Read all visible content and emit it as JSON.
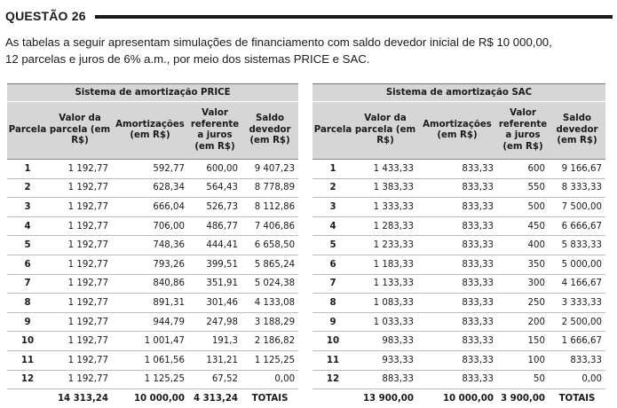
{
  "question": {
    "title": "QUESTÃO 26"
  },
  "intro": {
    "line1": "As tabelas a seguir apresentam simulações de financiamento com saldo devedor inicial de R$ 10 000,00,",
    "line2": "12 parcelas e juros de 6% a.m., por meio dos sistemas PRICE e SAC."
  },
  "tables": {
    "price": {
      "title": "Sistema de amortização PRICE",
      "headers": [
        "Parcela",
        "Valor da parcela (em R$)",
        "Amortizações (em R$)",
        "Valor referente a juros (em R$)",
        "Saldo devedor (em R$)"
      ],
      "rows": [
        [
          "1",
          "1 192,77",
          "592,77",
          "600,00",
          "9 407,23"
        ],
        [
          "2",
          "1 192,77",
          "628,34",
          "564,43",
          "8 778,89"
        ],
        [
          "3",
          "1 192,77",
          "666,04",
          "526,73",
          "8 112,86"
        ],
        [
          "4",
          "1 192,77",
          "706,00",
          "486,77",
          "7 406,86"
        ],
        [
          "5",
          "1 192,77",
          "748,36",
          "444,41",
          "6 658,50"
        ],
        [
          "6",
          "1 192,77",
          "793,26",
          "399,51",
          "5 865,24"
        ],
        [
          "7",
          "1 192,77",
          "840,86",
          "351,91",
          "5 024,38"
        ],
        [
          "8",
          "1 192,77",
          "891,31",
          "301,46",
          "4 133,08"
        ],
        [
          "9",
          "1 192,77",
          "944,79",
          "247,98",
          "3 188,29"
        ],
        [
          "10",
          "1 192,77",
          "1 001,47",
          "191,3",
          "2 186,82"
        ],
        [
          "11",
          "1 192,77",
          "1 061,56",
          "131,21",
          "1 125,25"
        ],
        [
          "12",
          "1 192,77",
          "1 125,25",
          "67,52",
          "0,00"
        ]
      ],
      "totals": [
        "14 313,24",
        "10 000,00",
        "4 313,24",
        "TOTAIS"
      ]
    },
    "sac": {
      "title": "Sistema de amortização SAC",
      "headers": [
        "Parcela",
        "Valor da parcela (em R$)",
        "Amortizações (em R$)",
        "Valor referente a juros (em R$)",
        "Saldo devedor (em R$)"
      ],
      "rows": [
        [
          "1",
          "1 433,33",
          "833,33",
          "600",
          "9 166,67"
        ],
        [
          "2",
          "1 383,33",
          "833,33",
          "550",
          "8 333,33"
        ],
        [
          "3",
          "1 333,33",
          "833,33",
          "500",
          "7 500,00"
        ],
        [
          "4",
          "1 283,33",
          "833,33",
          "450",
          "6 666,67"
        ],
        [
          "5",
          "1 233,33",
          "833,33",
          "400",
          "5 833,33"
        ],
        [
          "6",
          "1 183,33",
          "833,33",
          "350",
          "5 000,00"
        ],
        [
          "7",
          "1 133,33",
          "833,33",
          "300",
          "4 166,67"
        ],
        [
          "8",
          "1 083,33",
          "833,33",
          "250",
          "3 333,33"
        ],
        [
          "9",
          "1 033,33",
          "833,33",
          "200",
          "2 500,00"
        ],
        [
          "10",
          "983,33",
          "833,33",
          "150",
          "1 666,67"
        ],
        [
          "11",
          "933,33",
          "833,33",
          "100",
          "833,33"
        ],
        [
          "12",
          "883,33",
          "833,33",
          "50",
          "0,00"
        ]
      ],
      "totals": [
        "13 900,00",
        "10 000,00",
        "3 900,00",
        "TOTAIS"
      ]
    }
  }
}
